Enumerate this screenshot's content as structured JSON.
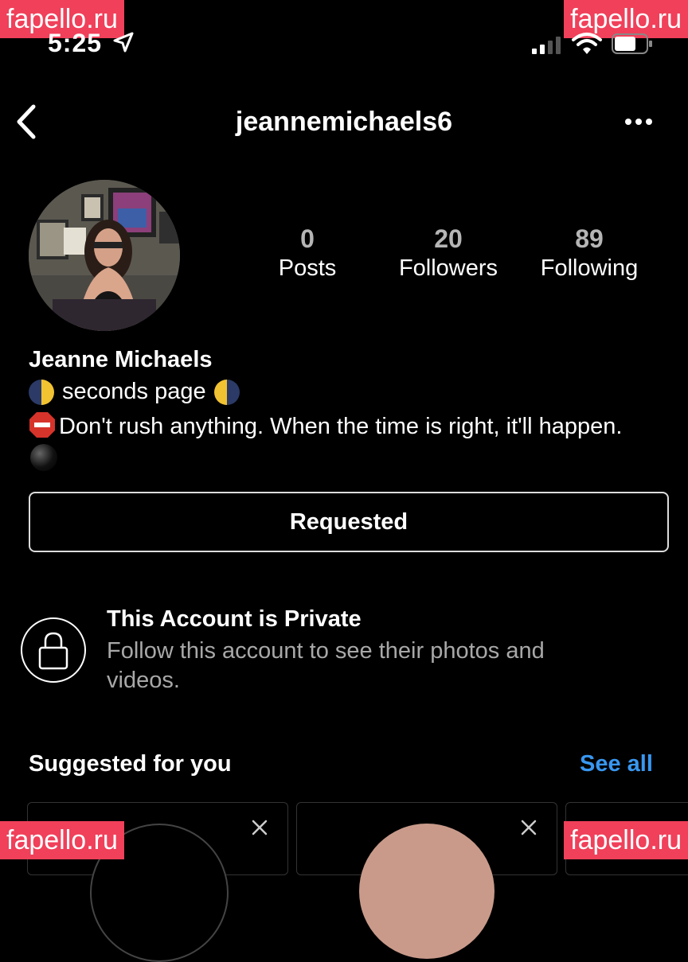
{
  "status_bar": {
    "time": "5:25"
  },
  "watermarks": {
    "text": "fapello.ru"
  },
  "header": {
    "username": "jeannemichaels6"
  },
  "stats": {
    "posts": {
      "value": "0",
      "label": "Posts"
    },
    "followers": {
      "value": "20",
      "label": "Followers"
    },
    "following": {
      "value": "89",
      "label": "Following"
    }
  },
  "bio": {
    "name": "Jeanne Michaels",
    "line1": "seconds page",
    "line2": "Don't rush anything. When the time is right, it'll happen."
  },
  "requested_button": {
    "label": "Requested"
  },
  "private": {
    "title": "This Account is Private",
    "description": "Follow this account to see their photos and videos."
  },
  "suggested": {
    "title": "Suggested for you",
    "see_all": "See all"
  },
  "colors": {
    "background": "#000000",
    "link": "#3897f0",
    "watermark": "#f0405a",
    "muted": "#a8a8a8"
  },
  "icons": [
    "location-arrow-icon",
    "signal-icon",
    "wifi-icon",
    "battery-icon",
    "back-chevron-icon",
    "more-icon",
    "lock-icon",
    "close-icon",
    "moon-emoji-icon",
    "stop-sign-emoji-icon",
    "black-circle-emoji-icon"
  ]
}
